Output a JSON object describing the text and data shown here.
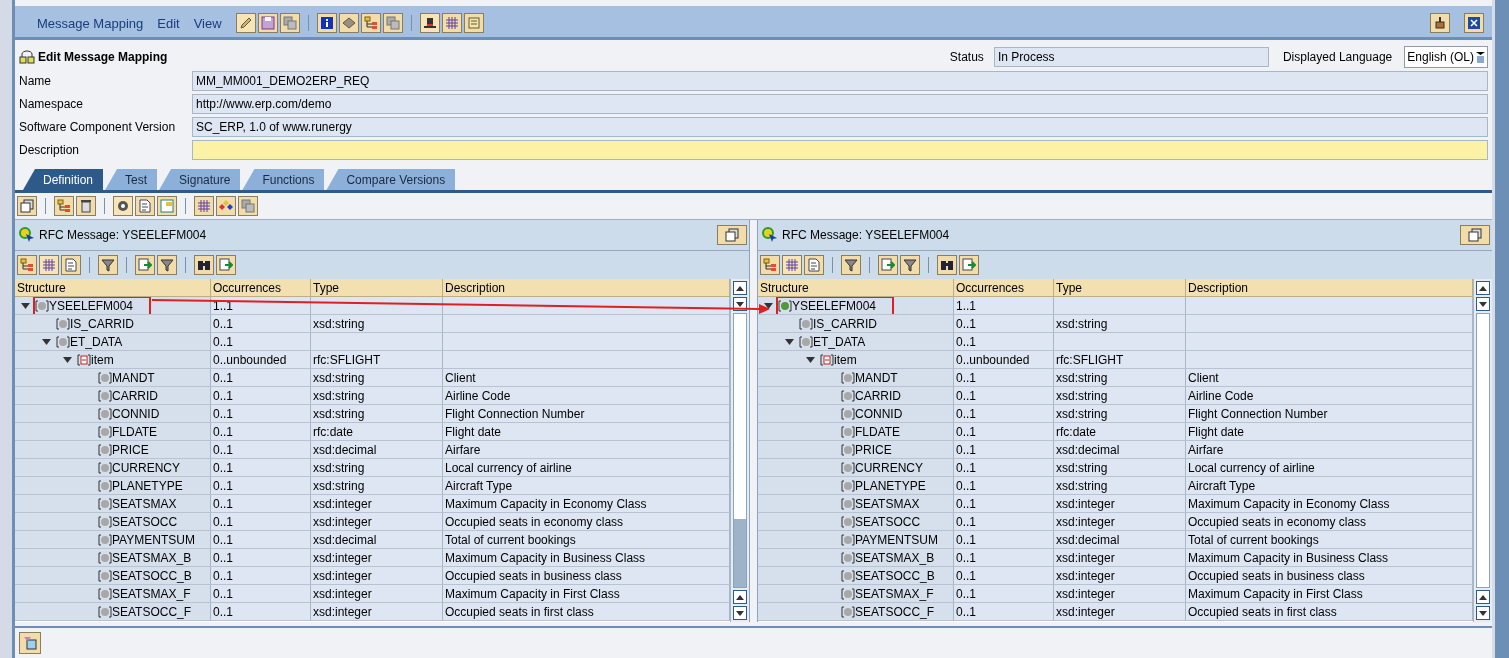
{
  "menu": [
    "Message Mapping",
    "Edit",
    "View"
  ],
  "editor": {
    "title": "Edit Message Mapping",
    "status_label": "Status",
    "status": "In Process",
    "language_label": "Displayed Language",
    "language": "English (OL)"
  },
  "fields": [
    {
      "label": "Name",
      "value": "MM_MM001_DEMO2ERP_REQ",
      "required": false
    },
    {
      "label": "Namespace",
      "value": "http://www.erp.com/demo",
      "required": false
    },
    {
      "label": "Software Component Version",
      "value": "SC_ERP, 1.0 of www.runergy",
      "required": false
    },
    {
      "label": "Description",
      "required": true
    }
  ],
  "tabs": [
    {
      "label": "Definition",
      "selected": true
    },
    {
      "label": "Test",
      "selected": false
    },
    {
      "label": "Signature",
      "selected": false
    },
    {
      "label": "Functions",
      "selected": false
    },
    {
      "label": "Compare Versions",
      "selected": false
    }
  ],
  "panes": [
    {
      "title": "RFC Message: YSEELEFM004",
      "root_highlighted": true,
      "columns": [
        "Structure",
        "Occurrences",
        "Type",
        "Description"
      ],
      "tree": [
        {
          "name": "YSEELEFM004",
          "occurrences": "1..1",
          "kind": "element",
          "expanded": true,
          "children": [
            {
              "name": "IS_CARRID",
              "occurrences": "0..1",
              "type": "xsd:string",
              "kind": "element"
            },
            {
              "name": "ET_DATA",
              "occurrences": "0..1",
              "kind": "element",
              "expanded": true,
              "children": [
                {
                  "name": "item",
                  "occurrences": "0..unbounded",
                  "type": "rfc:SFLIGHT",
                  "kind": "table",
                  "expanded": true,
                  "children": [
                    {
                      "name": "MANDT",
                      "occurrences": "0..1",
                      "type": "xsd:string",
                      "description": "Client",
                      "kind": "element"
                    },
                    {
                      "name": "CARRID",
                      "occurrences": "0..1",
                      "type": "xsd:string",
                      "description": "Airline Code",
                      "kind": "element"
                    },
                    {
                      "name": "CONNID",
                      "occurrences": "0..1",
                      "type": "xsd:string",
                      "description": "Flight Connection Number",
                      "kind": "element"
                    },
                    {
                      "name": "FLDATE",
                      "occurrences": "0..1",
                      "type": "rfc:date",
                      "description": "Flight date",
                      "kind": "element"
                    },
                    {
                      "name": "PRICE",
                      "occurrences": "0..1",
                      "type": "xsd:decimal",
                      "description": "Airfare",
                      "kind": "element"
                    },
                    {
                      "name": "CURRENCY",
                      "occurrences": "0..1",
                      "type": "xsd:string",
                      "description": "Local currency of airline",
                      "kind": "element"
                    },
                    {
                      "name": "PLANETYPE",
                      "occurrences": "0..1",
                      "type": "xsd:string",
                      "description": "Aircraft Type",
                      "kind": "element"
                    },
                    {
                      "name": "SEATSMAX",
                      "occurrences": "0..1",
                      "type": "xsd:integer",
                      "description": "Maximum Capacity in Economy Class",
                      "kind": "element"
                    },
                    {
                      "name": "SEATSOCC",
                      "occurrences": "0..1",
                      "type": "xsd:integer",
                      "description": "Occupied seats in economy class",
                      "kind": "element"
                    },
                    {
                      "name": "PAYMENTSUM",
                      "occurrences": "0..1",
                      "type": "xsd:decimal",
                      "description": "Total of current bookings",
                      "kind": "element"
                    },
                    {
                      "name": "SEATSMAX_B",
                      "occurrences": "0..1",
                      "type": "xsd:integer",
                      "description": "Maximum Capacity in Business Class",
                      "kind": "element"
                    },
                    {
                      "name": "SEATSOCC_B",
                      "occurrences": "0..1",
                      "type": "xsd:integer",
                      "description": "Occupied seats in business class",
                      "kind": "element"
                    },
                    {
                      "name": "SEATSMAX_F",
                      "occurrences": "0..1",
                      "type": "xsd:integer",
                      "description": "Maximum Capacity in First Class",
                      "kind": "element"
                    },
                    {
                      "name": "SEATSOCC_F",
                      "occurrences": "0..1",
                      "type": "xsd:integer",
                      "description": "Occupied seats in first class",
                      "kind": "element"
                    }
                  ]
                }
              ]
            }
          ]
        }
      ]
    },
    {
      "title": "RFC Message: YSEELEFM004",
      "root_highlighted": true,
      "columns": [
        "Structure",
        "Occurrences",
        "Type",
        "Description"
      ],
      "tree": [
        {
          "name": "YSEELEFM004",
          "occurrences": "1..1",
          "kind": "mapped",
          "expanded": true,
          "children": [
            {
              "name": "IS_CARRID",
              "occurrences": "0..1",
              "type": "xsd:string",
              "kind": "element"
            },
            {
              "name": "ET_DATA",
              "occurrences": "0..1",
              "kind": "element",
              "expanded": true,
              "children": [
                {
                  "name": "item",
                  "occurrences": "0..unbounded",
                  "type": "rfc:SFLIGHT",
                  "kind": "table",
                  "expanded": true,
                  "children": [
                    {
                      "name": "MANDT",
                      "occurrences": "0..1",
                      "type": "xsd:string",
                      "description": "Client",
                      "kind": "element"
                    },
                    {
                      "name": "CARRID",
                      "occurrences": "0..1",
                      "type": "xsd:string",
                      "description": "Airline Code",
                      "kind": "element"
                    },
                    {
                      "name": "CONNID",
                      "occurrences": "0..1",
                      "type": "xsd:string",
                      "description": "Flight Connection Number",
                      "kind": "element"
                    },
                    {
                      "name": "FLDATE",
                      "occurrences": "0..1",
                      "type": "rfc:date",
                      "description": "Flight date",
                      "kind": "element"
                    },
                    {
                      "name": "PRICE",
                      "occurrences": "0..1",
                      "type": "xsd:decimal",
                      "description": "Airfare",
                      "kind": "element"
                    },
                    {
                      "name": "CURRENCY",
                      "occurrences": "0..1",
                      "type": "xsd:string",
                      "description": "Local currency of airline",
                      "kind": "element"
                    },
                    {
                      "name": "PLANETYPE",
                      "occurrences": "0..1",
                      "type": "xsd:string",
                      "description": "Aircraft Type",
                      "kind": "element"
                    },
                    {
                      "name": "SEATSMAX",
                      "occurrences": "0..1",
                      "type": "xsd:integer",
                      "description": "Maximum Capacity in Economy Class",
                      "kind": "element"
                    },
                    {
                      "name": "SEATSOCC",
                      "occurrences": "0..1",
                      "type": "xsd:integer",
                      "description": "Occupied seats in economy class",
                      "kind": "element"
                    },
                    {
                      "name": "PAYMENTSUM",
                      "occurrences": "0..1",
                      "type": "xsd:decimal",
                      "description": "Total of current bookings",
                      "kind": "element"
                    },
                    {
                      "name": "SEATSMAX_B",
                      "occurrences": "0..1",
                      "type": "xsd:integer",
                      "description": "Maximum Capacity in Business Class",
                      "kind": "element"
                    },
                    {
                      "name": "SEATSOCC_B",
                      "occurrences": "0..1",
                      "type": "xsd:integer",
                      "description": "Occupied seats in business class",
                      "kind": "element"
                    },
                    {
                      "name": "SEATSMAX_F",
                      "occurrences": "0..1",
                      "type": "xsd:integer",
                      "description": "Maximum Capacity in First Class",
                      "kind": "element"
                    },
                    {
                      "name": "SEATSOCC_F",
                      "occurrences": "0..1",
                      "type": "xsd:integer",
                      "description": "Occupied seats in first class",
                      "kind": "element"
                    }
                  ]
                }
              ]
            }
          ]
        }
      ]
    }
  ]
}
